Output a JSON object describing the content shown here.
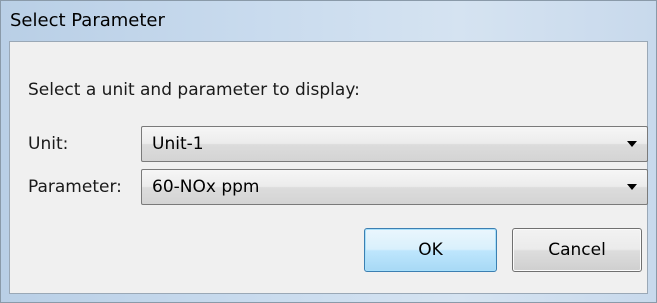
{
  "window": {
    "title": "Select Parameter"
  },
  "dialog": {
    "prompt": "Select a unit and parameter to display:",
    "unit_label": "Unit:",
    "unit_value": "Unit-1",
    "parameter_label": "Parameter:",
    "parameter_value": "60-NOx ppm",
    "ok_label": "OK",
    "cancel_label": "Cancel"
  },
  "icons": {
    "dropdown": "chevron-down-icon"
  },
  "colors": {
    "ok_border": "#3c7fb1",
    "ok_fill": "#bee6fd",
    "title_bar": "#c9dbee",
    "client_background": "#f0f0f0"
  }
}
